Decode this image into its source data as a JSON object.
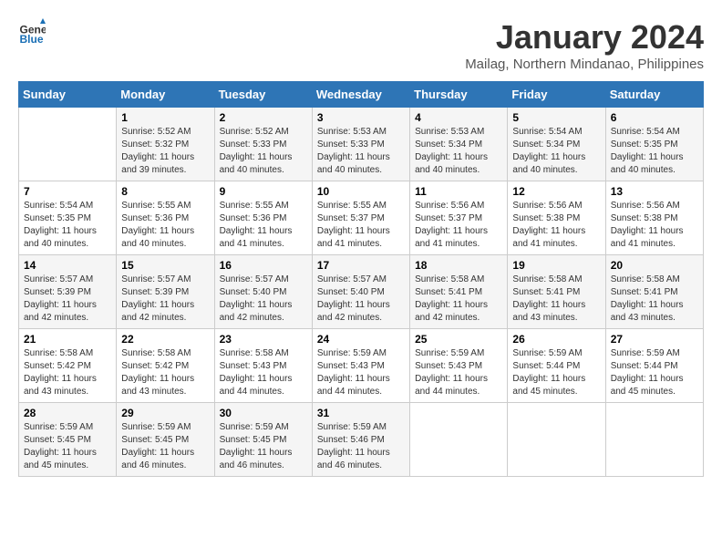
{
  "header": {
    "logo_line1": "General",
    "logo_line2": "Blue",
    "month": "January 2024",
    "location": "Mailag, Northern Mindanao, Philippines"
  },
  "days_of_week": [
    "Sunday",
    "Monday",
    "Tuesday",
    "Wednesday",
    "Thursday",
    "Friday",
    "Saturday"
  ],
  "weeks": [
    [
      {
        "num": "",
        "info": ""
      },
      {
        "num": "1",
        "info": "Sunrise: 5:52 AM\nSunset: 5:32 PM\nDaylight: 11 hours\nand 39 minutes."
      },
      {
        "num": "2",
        "info": "Sunrise: 5:52 AM\nSunset: 5:33 PM\nDaylight: 11 hours\nand 40 minutes."
      },
      {
        "num": "3",
        "info": "Sunrise: 5:53 AM\nSunset: 5:33 PM\nDaylight: 11 hours\nand 40 minutes."
      },
      {
        "num": "4",
        "info": "Sunrise: 5:53 AM\nSunset: 5:34 PM\nDaylight: 11 hours\nand 40 minutes."
      },
      {
        "num": "5",
        "info": "Sunrise: 5:54 AM\nSunset: 5:34 PM\nDaylight: 11 hours\nand 40 minutes."
      },
      {
        "num": "6",
        "info": "Sunrise: 5:54 AM\nSunset: 5:35 PM\nDaylight: 11 hours\nand 40 minutes."
      }
    ],
    [
      {
        "num": "7",
        "info": "Sunrise: 5:54 AM\nSunset: 5:35 PM\nDaylight: 11 hours\nand 40 minutes."
      },
      {
        "num": "8",
        "info": "Sunrise: 5:55 AM\nSunset: 5:36 PM\nDaylight: 11 hours\nand 40 minutes."
      },
      {
        "num": "9",
        "info": "Sunrise: 5:55 AM\nSunset: 5:36 PM\nDaylight: 11 hours\nand 41 minutes."
      },
      {
        "num": "10",
        "info": "Sunrise: 5:55 AM\nSunset: 5:37 PM\nDaylight: 11 hours\nand 41 minutes."
      },
      {
        "num": "11",
        "info": "Sunrise: 5:56 AM\nSunset: 5:37 PM\nDaylight: 11 hours\nand 41 minutes."
      },
      {
        "num": "12",
        "info": "Sunrise: 5:56 AM\nSunset: 5:38 PM\nDaylight: 11 hours\nand 41 minutes."
      },
      {
        "num": "13",
        "info": "Sunrise: 5:56 AM\nSunset: 5:38 PM\nDaylight: 11 hours\nand 41 minutes."
      }
    ],
    [
      {
        "num": "14",
        "info": "Sunrise: 5:57 AM\nSunset: 5:39 PM\nDaylight: 11 hours\nand 42 minutes."
      },
      {
        "num": "15",
        "info": "Sunrise: 5:57 AM\nSunset: 5:39 PM\nDaylight: 11 hours\nand 42 minutes."
      },
      {
        "num": "16",
        "info": "Sunrise: 5:57 AM\nSunset: 5:40 PM\nDaylight: 11 hours\nand 42 minutes."
      },
      {
        "num": "17",
        "info": "Sunrise: 5:57 AM\nSunset: 5:40 PM\nDaylight: 11 hours\nand 42 minutes."
      },
      {
        "num": "18",
        "info": "Sunrise: 5:58 AM\nSunset: 5:41 PM\nDaylight: 11 hours\nand 42 minutes."
      },
      {
        "num": "19",
        "info": "Sunrise: 5:58 AM\nSunset: 5:41 PM\nDaylight: 11 hours\nand 43 minutes."
      },
      {
        "num": "20",
        "info": "Sunrise: 5:58 AM\nSunset: 5:41 PM\nDaylight: 11 hours\nand 43 minutes."
      }
    ],
    [
      {
        "num": "21",
        "info": "Sunrise: 5:58 AM\nSunset: 5:42 PM\nDaylight: 11 hours\nand 43 minutes."
      },
      {
        "num": "22",
        "info": "Sunrise: 5:58 AM\nSunset: 5:42 PM\nDaylight: 11 hours\nand 43 minutes."
      },
      {
        "num": "23",
        "info": "Sunrise: 5:58 AM\nSunset: 5:43 PM\nDaylight: 11 hours\nand 44 minutes."
      },
      {
        "num": "24",
        "info": "Sunrise: 5:59 AM\nSunset: 5:43 PM\nDaylight: 11 hours\nand 44 minutes."
      },
      {
        "num": "25",
        "info": "Sunrise: 5:59 AM\nSunset: 5:43 PM\nDaylight: 11 hours\nand 44 minutes."
      },
      {
        "num": "26",
        "info": "Sunrise: 5:59 AM\nSunset: 5:44 PM\nDaylight: 11 hours\nand 45 minutes."
      },
      {
        "num": "27",
        "info": "Sunrise: 5:59 AM\nSunset: 5:44 PM\nDaylight: 11 hours\nand 45 minutes."
      }
    ],
    [
      {
        "num": "28",
        "info": "Sunrise: 5:59 AM\nSunset: 5:45 PM\nDaylight: 11 hours\nand 45 minutes."
      },
      {
        "num": "29",
        "info": "Sunrise: 5:59 AM\nSunset: 5:45 PM\nDaylight: 11 hours\nand 46 minutes."
      },
      {
        "num": "30",
        "info": "Sunrise: 5:59 AM\nSunset: 5:45 PM\nDaylight: 11 hours\nand 46 minutes."
      },
      {
        "num": "31",
        "info": "Sunrise: 5:59 AM\nSunset: 5:46 PM\nDaylight: 11 hours\nand 46 minutes."
      },
      {
        "num": "",
        "info": ""
      },
      {
        "num": "",
        "info": ""
      },
      {
        "num": "",
        "info": ""
      }
    ]
  ]
}
